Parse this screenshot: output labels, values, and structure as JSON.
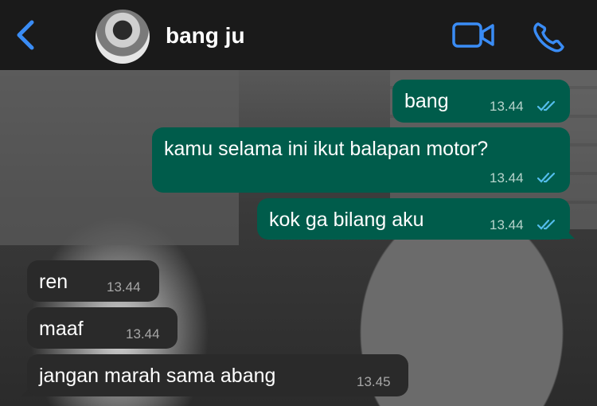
{
  "header": {
    "contact_name": "bang ju"
  },
  "messages": [
    {
      "direction": "outgoing",
      "text": "bang",
      "time": "13.44",
      "status": "read"
    },
    {
      "direction": "outgoing",
      "text": "kamu selama ini ikut balapan motor?",
      "time": "13.44",
      "status": "read"
    },
    {
      "direction": "outgoing",
      "text": "kok ga bilang aku",
      "time": "13.44",
      "status": "read"
    },
    {
      "direction": "incoming",
      "text": "ren",
      "time": "13.44"
    },
    {
      "direction": "incoming",
      "text": "maaf",
      "time": "13.44"
    },
    {
      "direction": "incoming",
      "text": "jangan marah sama abang",
      "time": "13.45"
    }
  ],
  "colors": {
    "accent": "#3a8cf5",
    "outgoing_bubble": "#005c4b",
    "incoming_bubble": "#2a2a2a",
    "read_ticks": "#53bdeb"
  },
  "icons": [
    "back-chevron-icon",
    "video-call-icon",
    "phone-call-icon",
    "double-check-icon"
  ]
}
